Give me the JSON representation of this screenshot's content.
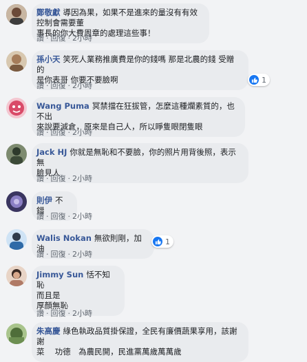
{
  "actions": {
    "like": "讚",
    "reply": "回復",
    "dot": "·"
  },
  "comments": [
    {
      "name": "鄭敬獻",
      "text": "導因為果，如果不是進來的量沒有有效控制會需要董\n事長的你大費周章的處理這些事！",
      "time": "2小時",
      "avatar_color": "#8a6d5a"
    },
    {
      "name": "孫小天",
      "text": "笑死人業務推廣費是你的錢嗎 那是北農的錢 受贈的\n是你表哥 你要不要臉啊",
      "time": "2小時",
      "reactions": "1",
      "avatar_color": "#c9a37a"
    },
    {
      "name": "Wang Puma",
      "text": "冥禁擋在狂拔管，怎麼這種爛素質的，也不出\n來說要減倉，原來是自己人，所以睜隻眼閉隻眼",
      "time": "2小時",
      "avatar_color": "#d94a68"
    },
    {
      "name": "Jack HJ",
      "text": "你就是無恥和不要臉，你的照片用背後照，表示無\n臉見人",
      "time": "2小時",
      "avatar_color": "#4a5a48"
    },
    {
      "name": "則伊",
      "text": "不錯",
      "time": "2小時",
      "avatar_color": "#5b4f86"
    },
    {
      "name": "Walis Nokan",
      "text": "無欲則剛，加油",
      "time": "2小時",
      "reactions": "1",
      "avatar_color": "#2f6aa7"
    },
    {
      "name": "Jimmy Sun",
      "text": "恬不知恥\n而且是\n厚顏無恥",
      "time": "2小時",
      "avatar_color": "#b07a66"
    },
    {
      "name": "朱高慶",
      "text": "綠色執政品質掛保證，全民有廉價蔬果享用，該謝謝\n菜 　功德　為農民開，民進黨萬歲萬萬歲",
      "time": "",
      "avatar_color": "#6d8f52"
    }
  ]
}
